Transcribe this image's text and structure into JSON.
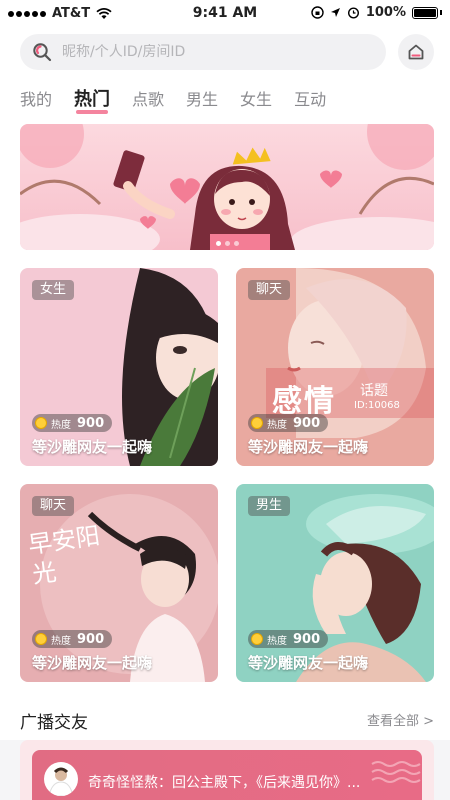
{
  "status_bar": {
    "carrier": "AT&T",
    "time": "9:41 AM",
    "battery": "100%"
  },
  "search": {
    "placeholder": "昵称/个人ID/房间ID",
    "value": ""
  },
  "tabs": [
    {
      "label": "我的"
    },
    {
      "label": "热门"
    },
    {
      "label": "点歌"
    },
    {
      "label": "男生"
    },
    {
      "label": "女生"
    },
    {
      "label": "互动"
    }
  ],
  "active_tab": "热门",
  "cards": [
    {
      "tag": "女生",
      "heat_label": "热度",
      "heat_value": "900",
      "title": "等沙雕网友一起嗨"
    },
    {
      "tag": "聊天",
      "heat_label": "热度",
      "heat_value": "900",
      "title": "等沙雕网友一起嗨",
      "overlay_text": "感情",
      "overlay_sub": "话题",
      "overlay_id": "ID:10068"
    },
    {
      "tag": "聊天",
      "heat_label": "热度",
      "heat_value": "900",
      "title": "等沙雕网友一起嗨",
      "overlay_text": "早安阳光"
    },
    {
      "tag": "男生",
      "heat_label": "热度",
      "heat_value": "900",
      "title": "等沙雕网友一起嗨"
    }
  ],
  "broadcast": {
    "title": "广播交友",
    "see_all": "查看全部 >",
    "message": "奇奇怪怪熬：回公主殿下，《后来遇见你》..."
  },
  "colors": {
    "accent": "#f05b7d",
    "banner_pink": "#f7bfca"
  },
  "icons": {
    "search": "search-icon",
    "home": "home-icon"
  }
}
